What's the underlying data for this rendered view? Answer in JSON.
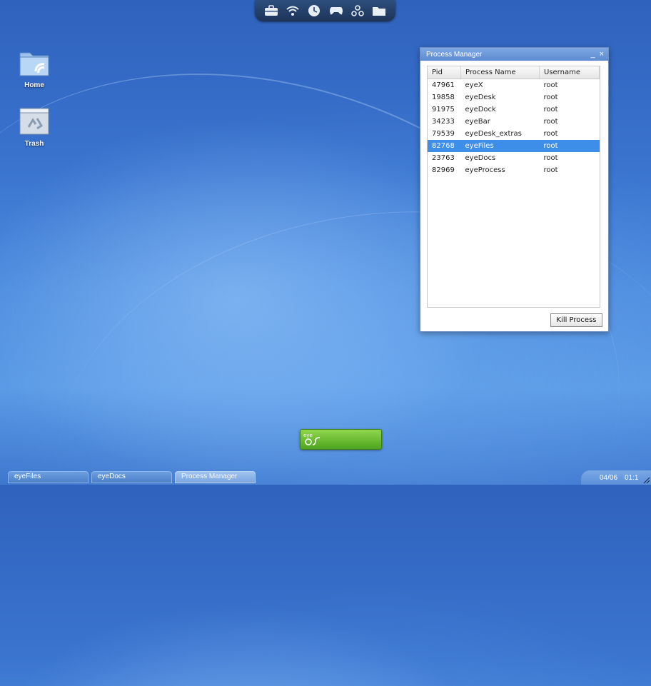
{
  "top_dock": {
    "icons": [
      "briefcase-icon",
      "wifi-icon",
      "clock-icon",
      "gamepad-icon",
      "network-icon",
      "folder-icon"
    ]
  },
  "desktop": {
    "icons": [
      {
        "label": "Home",
        "icon": "home-folder-icon"
      },
      {
        "label": "Trash",
        "icon": "trash-icon"
      }
    ]
  },
  "window": {
    "title": "Process Manager",
    "minimize": "_",
    "close": "×",
    "columns": [
      "Pid",
      "Process Name",
      "Username"
    ],
    "rows": [
      {
        "pid": "47961",
        "name": "eyeX",
        "user": "root"
      },
      {
        "pid": "19858",
        "name": "eyeDesk",
        "user": "root"
      },
      {
        "pid": "91975",
        "name": "eyeDock",
        "user": "root"
      },
      {
        "pid": "34233",
        "name": "eyeBar",
        "user": "root"
      },
      {
        "pid": "79539",
        "name": "eyeDesk_extras",
        "user": "root"
      },
      {
        "pid": "82768",
        "name": "eyeFiles",
        "user": "root"
      },
      {
        "pid": "23763",
        "name": "eyeDocs",
        "user": "root"
      },
      {
        "pid": "82969",
        "name": "eyeProcess",
        "user": "root"
      }
    ],
    "selected_pid": "82768",
    "kill_button": "Kill Process"
  },
  "launcher": {
    "icon": "eye-logo-icon",
    "color": "#6bbf35"
  },
  "taskbar": {
    "tasks": [
      {
        "label": "eyeFiles",
        "active": false
      },
      {
        "label": "eyeDocs",
        "active": false
      },
      {
        "label": "Process Manager",
        "active": true
      }
    ],
    "date": "04/06",
    "time": "01:1"
  },
  "colors": {
    "accent": "#3d8ee9",
    "titlebar": "#6f9ad8",
    "launcher_green": "#6bbf35"
  }
}
